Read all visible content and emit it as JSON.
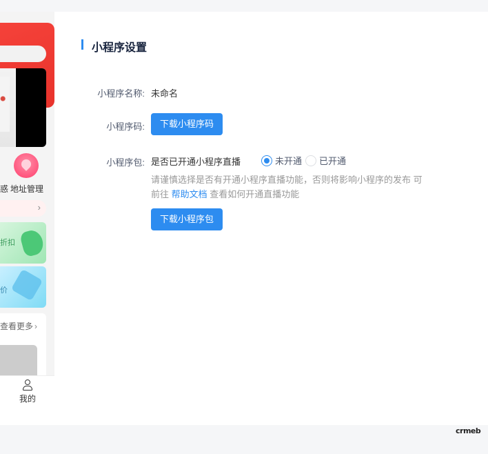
{
  "phone_preview": {
    "icon_cut_label": "惑",
    "icon_addr_label": "地址管理",
    "promo_green_text": "折扣",
    "promo_blue_text": "价",
    "more_text": "查看更多",
    "tab_me_label": "我的"
  },
  "settings": {
    "section_title": "小程序设置",
    "name_label": "小程序名称:",
    "name_value": "未命名",
    "code_label": "小程序码:",
    "download_code_button": "下载小程序码",
    "package_label": "小程序包:",
    "live_question": "是否已开通小程序直播",
    "radio_not_opened": "未开通",
    "radio_opened": "已开通",
    "selected_option": "未开通",
    "hint_part1": "请谨慎选择是否有开通小程序直播功能，否则将影响小程序的发布 可前往",
    "hint_link": "帮助文档",
    "hint_part2": "查看如何开通直播功能",
    "download_package_button": "下载小程序包"
  },
  "footer": {
    "logo_text": "crmeb"
  },
  "colors": {
    "primary": "#2d8cf0",
    "header_red": "#f5423a",
    "background": "#f5f6f8"
  }
}
